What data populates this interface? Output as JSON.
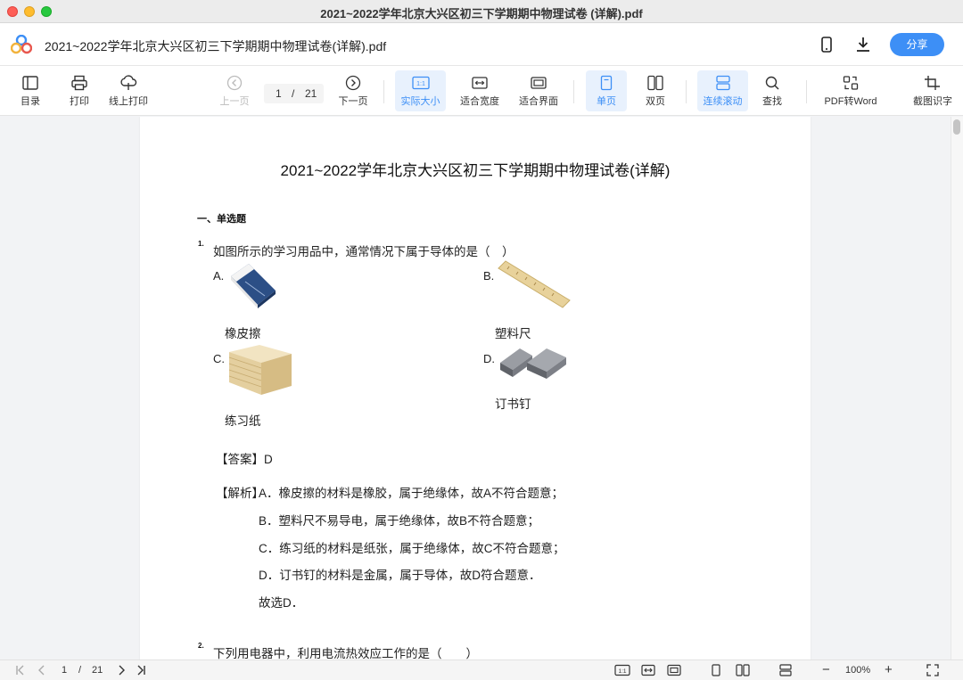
{
  "window": {
    "title": "2021~2022学年北京大兴区初三下学期期中物理试卷 (详解).pdf"
  },
  "header": {
    "doc_name": "2021~2022学年北京大兴区初三下学期期中物理试卷(详解).pdf",
    "share_label": "分享",
    "icons": [
      "app-logo",
      "phone-icon",
      "download-icon"
    ]
  },
  "toolbar": {
    "toc": "目录",
    "print": "打印",
    "online_print": "线上打印",
    "prev_page": "上一页",
    "current_page": "1",
    "page_sep": "/",
    "total_pages": "21",
    "next_page": "下一页",
    "actual_size": "实际大小",
    "actual_size_glyph": "1:1",
    "fit_width": "适合宽度",
    "fit_window": "适合界面",
    "single_page": "单页",
    "double_page": "双页",
    "continuous_scroll": "连续滚动",
    "find": "查找",
    "pdf_to_word": "PDF转Word",
    "ocr": "截图识字",
    "accent_color": "#3d8ff6"
  },
  "document": {
    "title": "2021~2022学年北京大兴区初三下学期期中物理试卷(详解)",
    "section": "一、单选题",
    "q1": {
      "number": "1.",
      "text": "如图所示的学习用品中，通常情况下属于导体的是（　）",
      "options": [
        {
          "letter": "A.",
          "caption": "橡皮擦"
        },
        {
          "letter": "B.",
          "caption": "塑料尺"
        },
        {
          "letter": "C.",
          "caption": "练习纸"
        },
        {
          "letter": "D.",
          "caption": "订书钉"
        }
      ],
      "answer": "【答案】D",
      "analysis_label": "【解析】",
      "analysis": [
        "A．橡皮擦的材料是橡胶，属于绝缘体，故A不符合题意；",
        "B．塑料尺不易导电，属于绝缘体，故B不符合题意；",
        "C．练习纸的材料是纸张，属于绝缘体，故C不符合题意；",
        "D．订书钉的材料是金属，属于导体，故D符合题意．",
        "故选D．"
      ]
    },
    "q2": {
      "number": "2.",
      "text": "下列用电器中，利用电流热效应工作的是（　　）"
    }
  },
  "statusbar": {
    "current_page": "1",
    "page_sep": "/",
    "total_pages": "21",
    "zoom_out": "−",
    "zoom": "100%",
    "zoom_in": "+",
    "actual_size_glyph": "1:1"
  }
}
